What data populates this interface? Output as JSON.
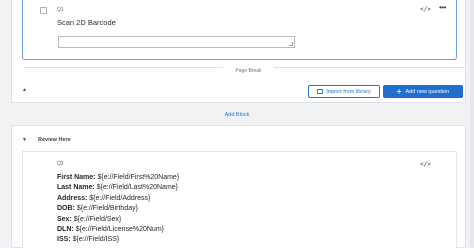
{
  "block1": {
    "question": {
      "id": "Q1",
      "text": "Scan 2D Barcode",
      "textarea_value": ""
    },
    "icons": {
      "code": "</>",
      "more": "•••",
      "collapse": "▲"
    },
    "page_break_label": "Page Break",
    "import_button_label": "Import from library",
    "add_question_button_label": "Add new question"
  },
  "add_block_label": "Add Block",
  "block2": {
    "title": "Review Here",
    "icons": {
      "collapse": "▼",
      "code": "</>"
    },
    "question": {
      "id": "Q2",
      "lines": [
        {
          "label": "First Name:",
          "value": " ${e://Field/First%20Name}"
        },
        {
          "label": "Last Name:",
          "value": " ${e://Field/Last%20Name}"
        },
        {
          "label": "Address:",
          "value": " ${e://Field/Address}"
        },
        {
          "label": "DOB:",
          "value": " ${e://Field/Birthday}"
        },
        {
          "label": "Sex:",
          "value": " ${e://Field/Sex}"
        },
        {
          "label": "DLN:",
          "value": " ${e://Field/License%20Num}"
        },
        {
          "label": "ISS:",
          "value": " ${e://Field/ISS}"
        }
      ]
    }
  }
}
